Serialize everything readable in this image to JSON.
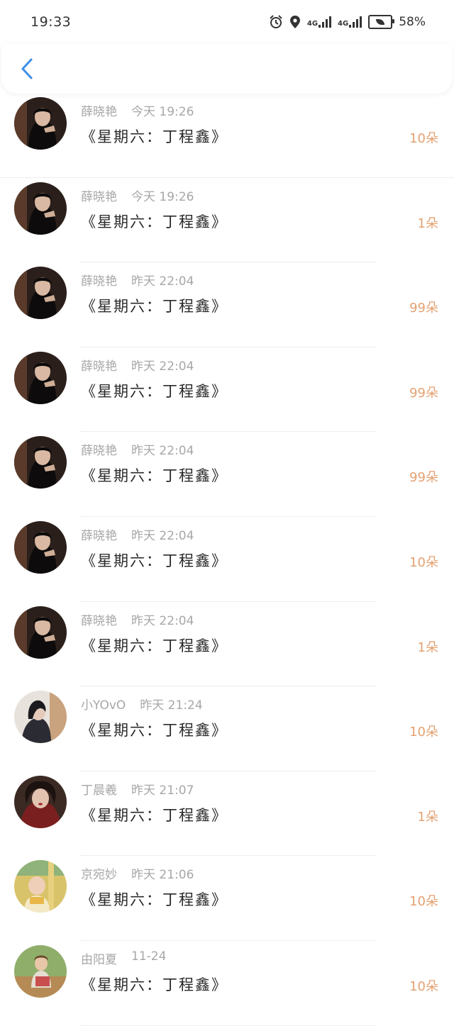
{
  "status": {
    "time": "19:33",
    "network1": "4G",
    "network2": "4G",
    "battery": "58%"
  },
  "nav": {
    "back_icon": "chevron-left-icon",
    "accent": "#3d8ee8"
  },
  "colors": {
    "count": "#e4a171",
    "meta": "#a7a7a7"
  },
  "items": [
    {
      "name": "薛晓艳",
      "time": "今天 19:26",
      "gift": "《星期六：丁程鑫》",
      "count": "10朵",
      "avatar": "dark-portrait"
    },
    {
      "name": "薛晓艳",
      "time": "今天 19:26",
      "gift": "《星期六：丁程鑫》",
      "count": "1朵",
      "avatar": "dark-portrait"
    },
    {
      "name": "薛晓艳",
      "time": "昨天 22:04",
      "gift": "《星期六：丁程鑫》",
      "count": "99朵",
      "avatar": "dark-portrait"
    },
    {
      "name": "薛晓艳",
      "time": "昨天 22:04",
      "gift": "《星期六：丁程鑫》",
      "count": "99朵",
      "avatar": "dark-portrait"
    },
    {
      "name": "薛晓艳",
      "time": "昨天 22:04",
      "gift": "《星期六：丁程鑫》",
      "count": "99朵",
      "avatar": "dark-portrait"
    },
    {
      "name": "薛晓艳",
      "time": "昨天 22:04",
      "gift": "《星期六：丁程鑫》",
      "count": "10朵",
      "avatar": "dark-portrait"
    },
    {
      "name": "薛晓艳",
      "time": "昨天 22:04",
      "gift": "《星期六：丁程鑫》",
      "count": "1朵",
      "avatar": "dark-portrait"
    },
    {
      "name": "小YOvO",
      "time": "昨天 21:24",
      "gift": "《星期六：丁程鑫》",
      "count": "10朵",
      "avatar": "girl-portrait"
    },
    {
      "name": "丁晨羲",
      "time": "昨天 21:07",
      "gift": "《星期六：丁程鑫》",
      "count": "1朵",
      "avatar": "red-portrait"
    },
    {
      "name": "京宛妙",
      "time": "昨天 21:06",
      "gift": "《星期六：丁程鑫》",
      "count": "10朵",
      "avatar": "baby-portrait"
    },
    {
      "name": "由阳夏",
      "time": "11-24",
      "gift": "《星期六：丁程鑫》",
      "count": "10朵",
      "avatar": "child-portrait"
    }
  ]
}
